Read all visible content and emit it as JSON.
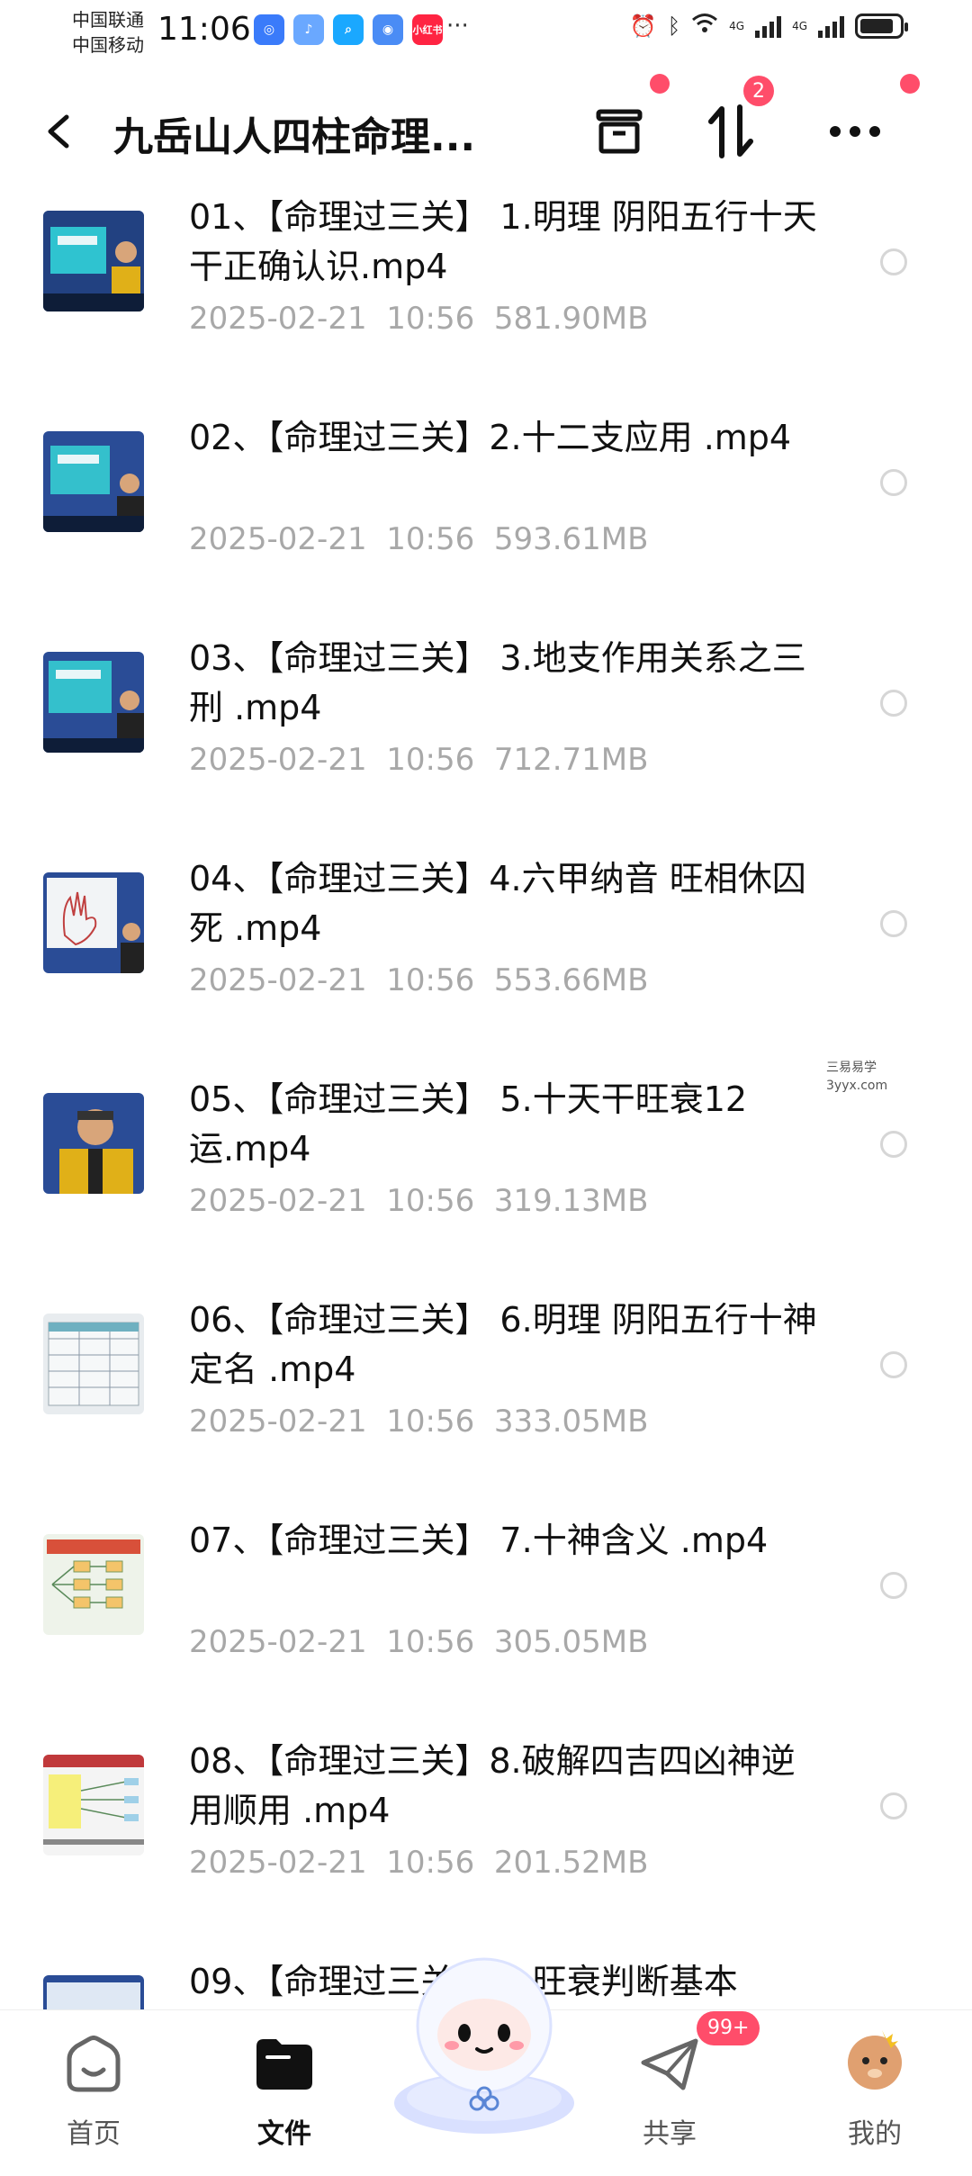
{
  "status_bar": {
    "carrier_1": "中国联通",
    "carrier_2": "中国移动",
    "time": "11:06",
    "app_icons": [
      "baidu-netdisk-icon",
      "music-icon",
      "search-app-icon",
      "browser-icon",
      "xiaohongshu-icon"
    ],
    "xiaohongshu_label": "小红书",
    "more": "···",
    "network_1": "4G",
    "network_2": "4G"
  },
  "header": {
    "title": "九岳山人四柱命理...",
    "transfer_badge": "2"
  },
  "files": [
    {
      "name": "01、【命理过三关】 1.明理 阴阳五行十天干正确认识.mp4",
      "date": "2025-02-21",
      "time": "10:56",
      "size": "581.90MB"
    },
    {
      "name": "02、【命理过三关】2.十二支应用 .mp4",
      "date": "2025-02-21",
      "time": "10:56",
      "size": "593.61MB"
    },
    {
      "name": "03、【命理过三关】 3.地支作用关系之三刑  .mp4",
      "date": "2025-02-21",
      "time": "10:56",
      "size": "712.71MB"
    },
    {
      "name": "04、【命理过三关】4.六甲纳音 旺相休囚死 .mp4",
      "date": "2025-02-21",
      "time": "10:56",
      "size": "553.66MB"
    },
    {
      "name": "05、【命理过三关】 5.十天干旺衰12运.mp4",
      "date": "2025-02-21",
      "time": "10:56",
      "size": "319.13MB"
    },
    {
      "name": "06、【命理过三关】 6.明理 阴阳五行十神定名 .mp4",
      "date": "2025-02-21",
      "time": "10:56",
      "size": "333.05MB"
    },
    {
      "name": "07、【命理过三关】 7.十神含义 .mp4",
      "date": "2025-02-21",
      "time": "10:56",
      "size": "305.05MB"
    },
    {
      "name": "08、【命理过三关】8.破解四吉四凶神逆用顺用 .mp4",
      "date": "2025-02-21",
      "time": "10:56",
      "size": "201.52MB"
    },
    {
      "name": "09、【命理过三关】 9.旺衰判断基本",
      "date": "",
      "time": "",
      "size": ""
    }
  ],
  "watermark": {
    "line1": "三易易学",
    "line2": "3yyx.com"
  },
  "bottom_nav": {
    "home": "首页",
    "files": "文件",
    "share": "共享",
    "share_badge": "99+",
    "mine": "我的"
  }
}
